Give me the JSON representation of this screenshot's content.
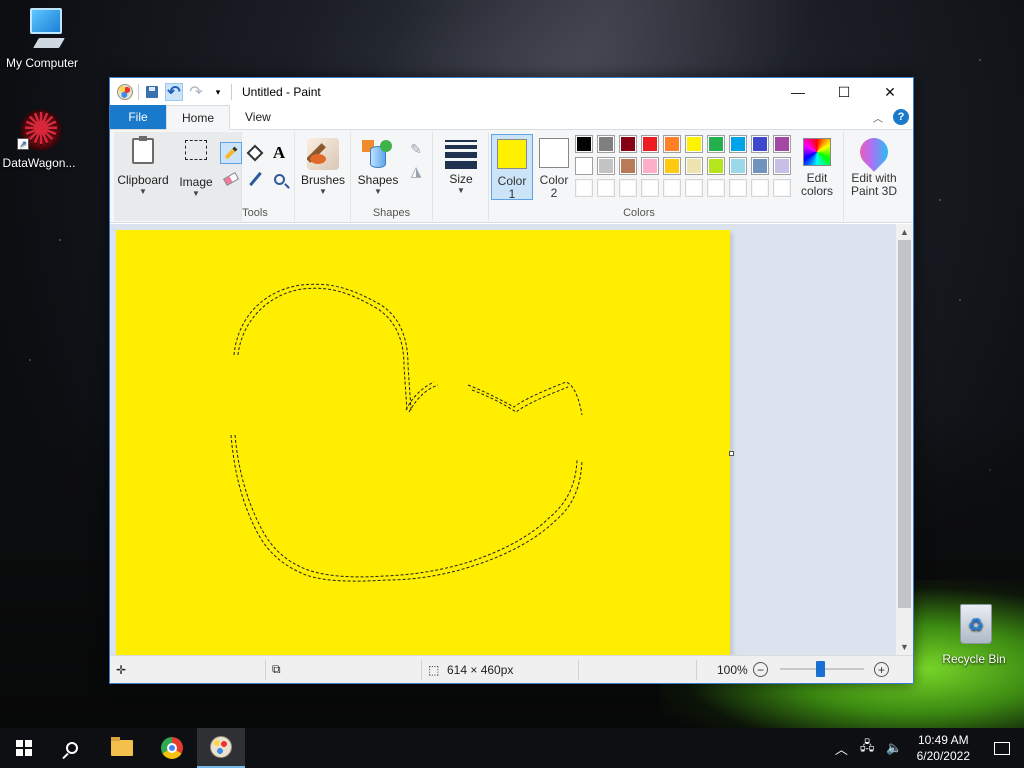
{
  "desktop": {
    "icons": [
      {
        "label": "My Computer",
        "icon": "my-computer-icon"
      },
      {
        "label": "DataWagon...",
        "icon": "datawagon-icon"
      },
      {
        "label": "Recycle Bin",
        "icon": "recycle-bin-icon"
      }
    ]
  },
  "window": {
    "title": "Untitled - Paint",
    "quick_access": [
      "paint-app-icon",
      "save-icon",
      "undo-icon",
      "redo-icon",
      "customize-dropdown-icon"
    ],
    "controls": {
      "minimize": "—",
      "maximize": "☐",
      "close": "✕"
    }
  },
  "ribbon": {
    "tabs": [
      {
        "label": "File",
        "active": false
      },
      {
        "label": "Home",
        "active": true
      },
      {
        "label": "View",
        "active": false
      }
    ],
    "groups": {
      "clipboard": {
        "label": "Clipboard"
      },
      "image": {
        "label": "Image"
      },
      "tools": {
        "label": "Tools"
      },
      "brushes": {
        "label": "Brushes"
      },
      "shapes": {
        "label": "Shapes",
        "button_label": "Shapes"
      },
      "size": {
        "label": "Size"
      },
      "colors": {
        "label": "Colors"
      }
    },
    "color1": {
      "label_line1": "Color",
      "label_line2": "1",
      "value": "#fff200"
    },
    "color2": {
      "label_line1": "Color",
      "label_line2": "2",
      "value": "#ffffff"
    },
    "palette_row1": [
      "#000000",
      "#7f7f7f",
      "#880015",
      "#ed1c24",
      "#ff7f27",
      "#fff200",
      "#22b14c",
      "#00a2e8",
      "#3f48cc",
      "#a349a4"
    ],
    "palette_row2": [
      "#ffffff",
      "#c3c3c3",
      "#b97a57",
      "#ffaec9",
      "#ffc90e",
      "#efe4b0",
      "#b5e61d",
      "#99d9ea",
      "#7092be",
      "#c8bfe7"
    ],
    "edit_colors": {
      "line1": "Edit",
      "line2": "colors"
    },
    "paint3d": {
      "line1": "Edit with",
      "line2": "Paint 3D"
    }
  },
  "canvas": {
    "background": "#ffee00"
  },
  "statusbar": {
    "image_size": "614 × 460px",
    "zoom": "100%",
    "zoom_out": "−",
    "zoom_in": "+"
  },
  "taskbar": {
    "time": "10:49 AM",
    "date": "6/20/2022"
  }
}
